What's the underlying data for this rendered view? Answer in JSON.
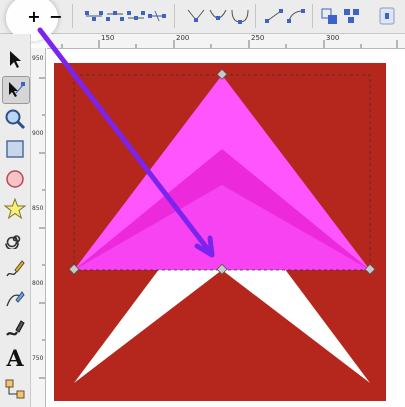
{
  "toolbar": {
    "buttons": [
      {
        "name": "insert-node-icon",
        "label": "+"
      },
      {
        "name": "delete-node-icon",
        "label": "−"
      },
      {
        "name": "join-nodes-icon"
      },
      {
        "name": "break-path-icon"
      },
      {
        "name": "join-segment-icon"
      },
      {
        "name": "delete-segment-icon"
      },
      {
        "name": "node-cusp-icon"
      },
      {
        "name": "node-smooth-icon"
      },
      {
        "name": "node-symmetric-icon"
      },
      {
        "name": "segment-line-icon"
      },
      {
        "name": "segment-curve-icon"
      },
      {
        "name": "object-to-path-icon"
      },
      {
        "name": "stroke-to-path-icon"
      },
      {
        "name": "show-transform-handles-icon"
      }
    ]
  },
  "ruler": {
    "h_labels": [
      "150",
      "200",
      "250",
      "300"
    ],
    "v_labels": [
      "950",
      "900",
      "850",
      "800",
      "750"
    ]
  },
  "tools": [
    {
      "name": "selector-tool-icon"
    },
    {
      "name": "node-tool-icon"
    },
    {
      "name": "zoom-tool-icon"
    },
    {
      "name": "rectangle-tool-icon"
    },
    {
      "name": "ellipse-tool-icon"
    },
    {
      "name": "star-tool-icon"
    },
    {
      "name": "spiral-tool-icon"
    },
    {
      "name": "pencil-tool-icon"
    },
    {
      "name": "pen-tool-icon"
    },
    {
      "name": "calligraphy-tool-icon"
    },
    {
      "name": "text-tool-icon",
      "label": "A"
    },
    {
      "name": "connector-tool-icon"
    }
  ],
  "colors": {
    "background": "#b5271d",
    "magenta": "#ff55ff",
    "magenta_dark": "#e61ccf",
    "white_shape": "#ffffff",
    "arrow": "#7b24ee"
  }
}
